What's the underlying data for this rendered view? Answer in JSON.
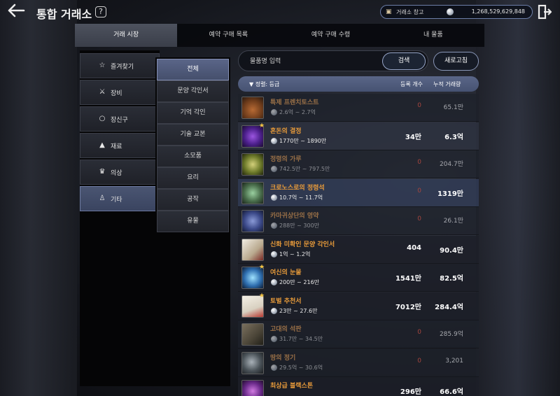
{
  "header": {
    "title": "통합 거래소",
    "help_icon_text": "?",
    "wallet": {
      "label": "거래소 창고",
      "amount": "1,268,529,629,848"
    }
  },
  "tabs": [
    {
      "label": "거래 시장",
      "active": true
    },
    {
      "label": "예약 구매 목록",
      "active": false
    },
    {
      "label": "예약 구매 수령",
      "active": false
    },
    {
      "label": "내 물품",
      "active": false
    }
  ],
  "categories": [
    {
      "label": "즐겨찾기",
      "icon": "star-icon"
    },
    {
      "label": "장비",
      "icon": "swords-icon"
    },
    {
      "label": "장신구",
      "icon": "ring-icon"
    },
    {
      "label": "재료",
      "icon": "potion-icon"
    },
    {
      "label": "의상",
      "icon": "costume-icon"
    },
    {
      "label": "기타",
      "icon": "flask-icon",
      "active": true
    }
  ],
  "subcategories": [
    {
      "label": "전체",
      "active": true
    },
    {
      "label": "문양 각인서"
    },
    {
      "label": "기억 각인"
    },
    {
      "label": "기술 교본"
    },
    {
      "label": "소모품"
    },
    {
      "label": "요리"
    },
    {
      "label": "공작"
    },
    {
      "label": "유물"
    }
  ],
  "search": {
    "placeholder": "물품명 입력",
    "button": "검색",
    "refresh": "새로고침"
  },
  "list_header": {
    "sort": "정렬: 등급",
    "count_col": "등록 개수",
    "volume_col": "누적 거래량"
  },
  "items": [
    {
      "name": "특제 프렌치토스트",
      "price": "2.6억 ~ 2.7억",
      "count": "0",
      "volume": "65.1만",
      "dim": true,
      "star": false,
      "bg": "dim"
    },
    {
      "name": "혼돈의 결정",
      "price": "1770만 ~ 1890만",
      "count": "34만",
      "volume": "6.3억",
      "dim": false,
      "star": true,
      "bg": "light"
    },
    {
      "name": "정령의 가루",
      "price": "742.5만 ~ 797.5만",
      "count": "0",
      "volume": "204.7만",
      "dim": true,
      "star": false,
      "bg": "dim"
    },
    {
      "name": "크로노스로의 정령석",
      "price": "10.7억 ~ 11.7억",
      "count": "0",
      "volume": "1319만",
      "dim": true,
      "star": false,
      "bg": "blue"
    },
    {
      "name": "카마귀상단의 영약",
      "price": "288만 ~ 300만",
      "count": "0",
      "volume": "26.1만",
      "dim": true,
      "star": false,
      "bg": "dim"
    },
    {
      "name": "신화 미확인 문양 각인서",
      "price": "1억 ~ 1.2억",
      "count": "404",
      "volume": "90.4만",
      "dim": false,
      "star": false,
      "bg": "normal"
    },
    {
      "name": "여신의 눈물",
      "price": "200만 ~ 216만",
      "count": "1541만",
      "volume": "82.5억",
      "dim": false,
      "star": true,
      "bg": "normal"
    },
    {
      "name": "토벌 추천서",
      "price": "23만 ~ 27.6만",
      "count": "7012만",
      "volume": "284.4억",
      "dim": false,
      "star": true,
      "bg": "normal"
    },
    {
      "name": "고대의 석판",
      "price": "31.7만 ~ 34.5만",
      "count": "0",
      "volume": "285.9억",
      "dim": true,
      "star": false,
      "bg": "dim"
    },
    {
      "name": "땅의 정기",
      "price": "29.5억 ~ 30.6억",
      "count": "0",
      "volume": "3,201",
      "dim": true,
      "star": false,
      "bg": "dim"
    },
    {
      "name": "최상급 블랙스톤",
      "price": "",
      "count": "296만",
      "volume": "66.6억",
      "dim": false,
      "star": false,
      "bg": "normal"
    }
  ],
  "colors": {
    "item_name": "#e89b3a",
    "zero_count": "#a6463f",
    "header_bar": "#52607f",
    "star": "#f5c542"
  }
}
